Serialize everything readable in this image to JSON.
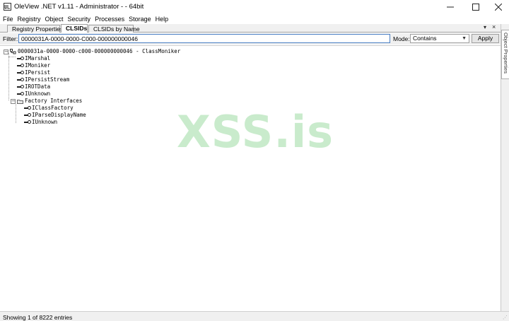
{
  "window": {
    "title": "OleView .NET v1.11 - Administrator - - 64bit",
    "icon": "app-logo-icon"
  },
  "menu": [
    "File",
    "Registry",
    "Object",
    "Security",
    "Processes",
    "Storage",
    "Help"
  ],
  "tabs": [
    {
      "label": "Registry Properties",
      "active": false
    },
    {
      "label": "CLSIDs",
      "active": true
    },
    {
      "label": "CLSIDs by Name",
      "active": false
    }
  ],
  "side_panel": {
    "label": "Object Properties"
  },
  "filter": {
    "label": "Filter:",
    "value": "0000031A-0000-0000-C000-000000000046",
    "mode_label": "Mode:",
    "mode_value": "Contains",
    "apply_label": "Apply"
  },
  "tree": {
    "root": "0000031a-0000-0000-c000-000000000046 - ClassMoniker",
    "interfaces": [
      "IMarshal",
      "IMoniker",
      "IPersist",
      "IPersistStream",
      "IROTData",
      "IUnknown"
    ],
    "factory_label": "Factory Interfaces",
    "factory_interfaces": [
      "IClassFactory",
      "IParseDisplayName",
      "IUnknown"
    ]
  },
  "watermark": "XSS.is",
  "status": {
    "text": "Showing 1 of 8222 entries"
  },
  "colors": {
    "accent": "#4a7fc4",
    "watermark": "#c9ebcc"
  }
}
